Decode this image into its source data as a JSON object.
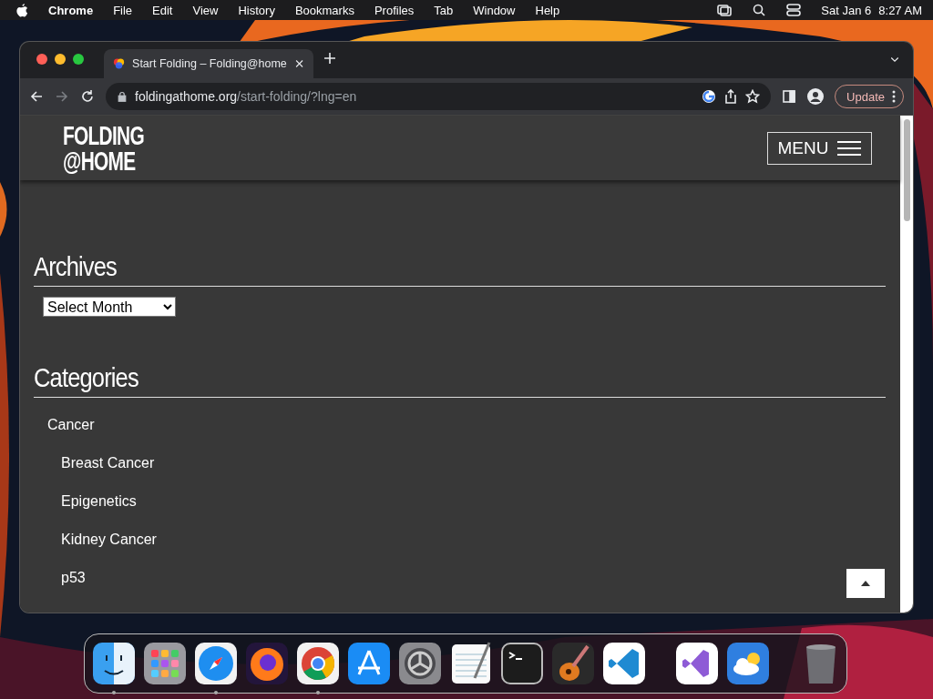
{
  "menu_bar": {
    "app": "Chrome",
    "items": [
      "File",
      "Edit",
      "View",
      "History",
      "Bookmarks",
      "Profiles",
      "Tab",
      "Window",
      "Help"
    ],
    "date": "Sat Jan 6",
    "time": "8:27 AM"
  },
  "browser": {
    "tab_title": "Start Folding – Folding@home",
    "url_host": "foldingathome.org",
    "url_path": "/start-folding/?lng=en",
    "update_label": "Update"
  },
  "page": {
    "logo": [
      "FOLDING",
      "@HOME"
    ],
    "menu_label": "MENU",
    "archives": {
      "heading": "Archives",
      "select_value": "Select Month"
    },
    "categories": {
      "heading": "Categories",
      "items": [
        {
          "label": "Cancer",
          "children": [
            {
              "label": "Breast Cancer"
            },
            {
              "label": "Epigenetics"
            },
            {
              "label": "Kidney Cancer"
            },
            {
              "label": "p53"
            }
          ]
        }
      ]
    }
  },
  "dock": [
    {
      "kind": "app",
      "running": true
    },
    {
      "kind": "app",
      "running": false
    },
    {
      "kind": "app",
      "running": true
    },
    {
      "kind": "app",
      "running": false
    },
    {
      "kind": "app",
      "running": true
    },
    {
      "kind": "app",
      "running": false
    },
    {
      "kind": "app",
      "running": false
    },
    {
      "kind": "app",
      "running": false
    },
    {
      "kind": "app",
      "running": false
    },
    {
      "kind": "app",
      "running": false
    },
    {
      "kind": "app",
      "running": false
    },
    {
      "kind": "separator"
    },
    {
      "kind": "app",
      "running": false
    },
    {
      "kind": "app",
      "running": false
    },
    {
      "kind": "separator"
    },
    {
      "kind": "app",
      "running": false
    }
  ]
}
